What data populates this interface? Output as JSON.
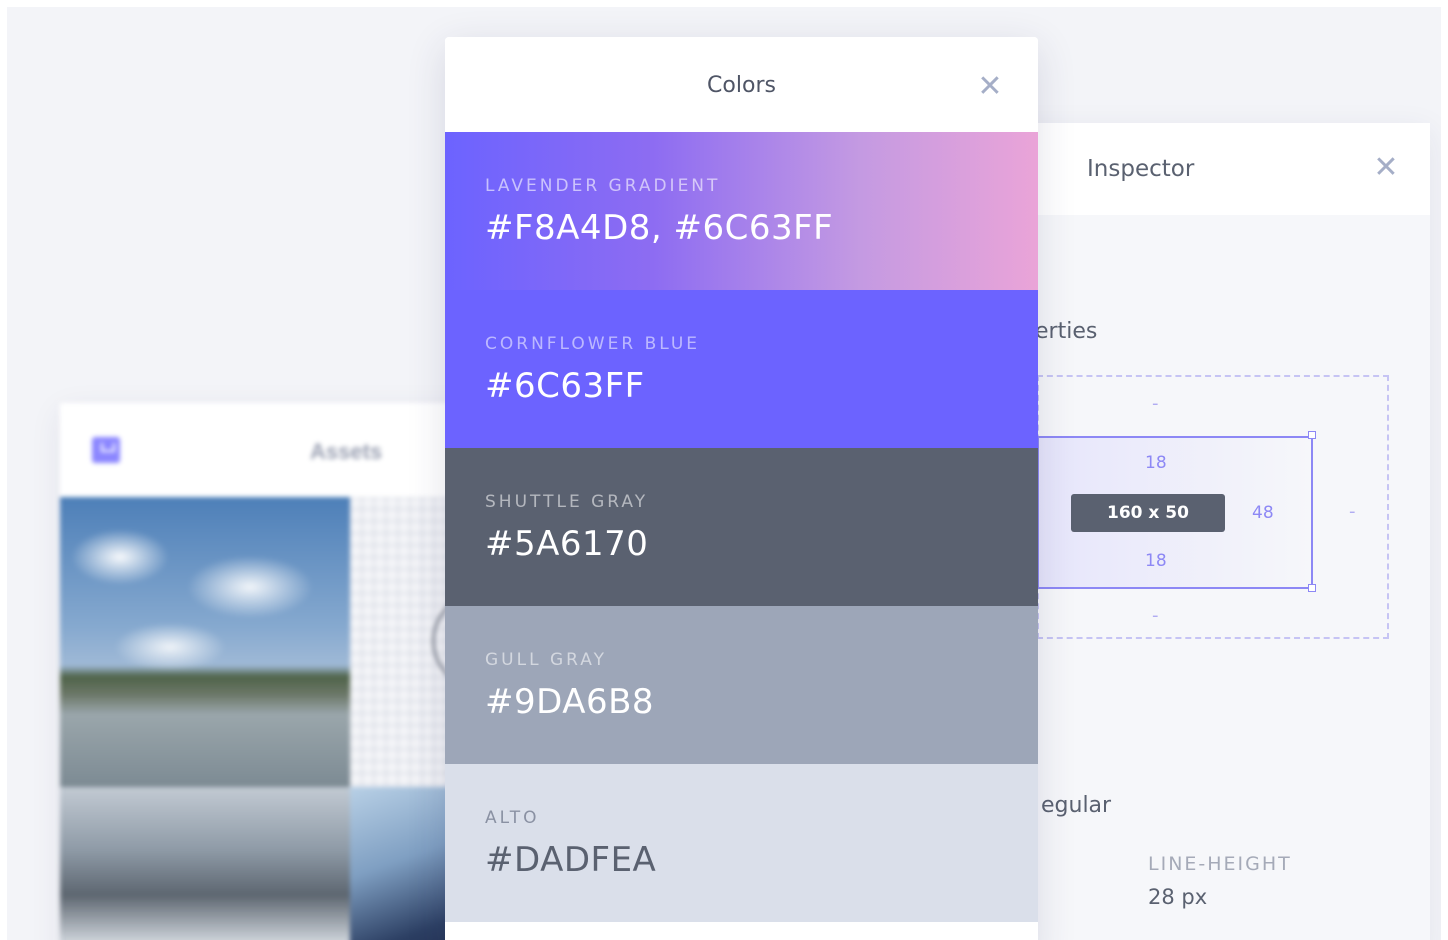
{
  "assets": {
    "title": "Assets",
    "icon": "download-icon"
  },
  "colors_panel": {
    "title": "Colors",
    "close_icon": "close-icon",
    "swatches": [
      {
        "name": "LAVENDER GRADIENT",
        "hex": "#F8A4D8, #6C63FF",
        "colors": [
          "#F8A4D8",
          "#6C63FF"
        ]
      },
      {
        "name": "CORNFLOWER BLUE",
        "hex": "#6C63FF",
        "color": "#6C63FF"
      },
      {
        "name": "SHUTTLE GRAY",
        "hex": "#5A6170",
        "color": "#5A6170"
      },
      {
        "name": "GULL GRAY",
        "hex": "#9DA6B8",
        "color": "#9DA6B8"
      },
      {
        "name": "ALTO",
        "hex": "#DADFEA",
        "color": "#DADFEA"
      }
    ]
  },
  "inspector": {
    "title": "Inspector",
    "close_icon": "close-icon",
    "section_label": "erties",
    "box_model": {
      "size": "160 x 50",
      "padding_top": "18",
      "padding_bottom": "18",
      "padding_right": "48",
      "margin_top": "-",
      "margin_bottom": "-",
      "margin_right": "-"
    },
    "font_weight": "egular",
    "line_height_label": "LINE-HEIGHT",
    "line_height_value": "28 px"
  },
  "theme": {
    "accent": "#6C63FF",
    "text_dark": "#5A6170",
    "muted": "#9DA6B8",
    "background": "#F3F4F8"
  }
}
